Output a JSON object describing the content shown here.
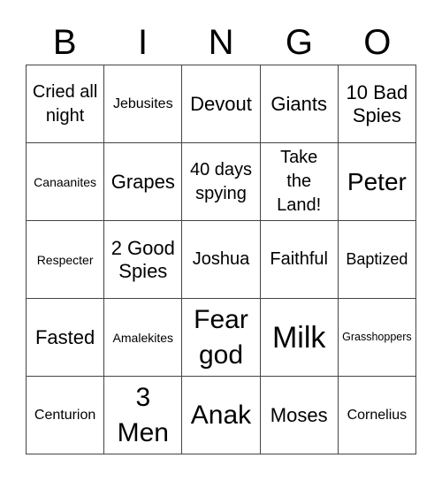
{
  "header": {
    "letters": [
      "B",
      "I",
      "N",
      "G",
      "O"
    ]
  },
  "grid": {
    "rows": [
      [
        "Cried all night",
        "Jebusites",
        "Devout",
        "Giants",
        "10 Bad Spies"
      ],
      [
        "Canaanites",
        "Grapes",
        "40 days spying",
        "Take the Land!",
        "Peter"
      ],
      [
        "Respecter",
        "2 Good Spies",
        "Joshua",
        "Faithful",
        "Baptized"
      ],
      [
        "Fasted",
        "Amalekites",
        "Fear god",
        "Milk",
        "Grasshoppers"
      ],
      [
        "Centurion",
        "3 Men",
        "Anak",
        "Moses",
        "Cornelius"
      ]
    ]
  }
}
